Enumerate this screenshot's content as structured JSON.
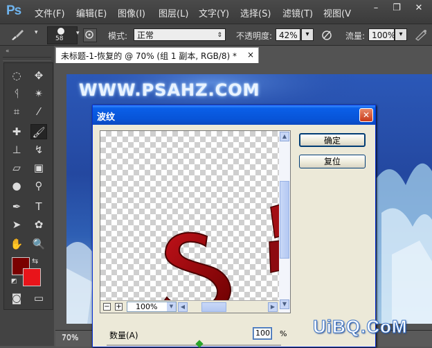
{
  "app": {
    "logo": "Ps"
  },
  "menu": [
    "文件(F)",
    "编辑(E)",
    "图像(I)",
    "图层(L)",
    "文字(Y)",
    "选择(S)",
    "滤镜(T)",
    "视图(V"
  ],
  "window_controls": {
    "minimize": "–",
    "restore": "❐",
    "close": "✕"
  },
  "options": {
    "brush_size": "58",
    "mode_label": "模式:",
    "mode_value": "正常",
    "opacity_label": "不透明度:",
    "opacity_value": "42%",
    "flow_label": "流量:",
    "flow_value": "100%"
  },
  "document": {
    "tab_title": "未标题-1-恢复的 @ 70% (组 1 副本, RGB/8) *",
    "tab_close": "×",
    "banner_text": "WWW.PSAHZ.COM",
    "zoom_status": "70%",
    "side_zoom": "70%"
  },
  "dialog": {
    "title": "波纹",
    "close": "✕",
    "ok_label": "确定",
    "reset_label": "复位",
    "zoom_value": "100%",
    "amount_label": "数量(A)",
    "amount_value": "100",
    "amount_unit": "%",
    "minus": "−",
    "plus": "+"
  },
  "watermark": "UiBQ.CoM",
  "colors": {
    "foreground": "#7a0000",
    "background": "#e8141a",
    "accent": "#0a5fe8"
  }
}
